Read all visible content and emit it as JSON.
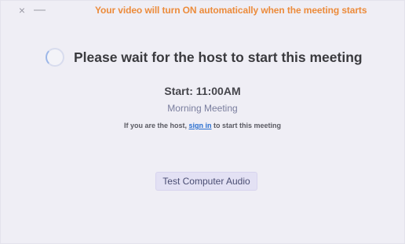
{
  "window": {
    "close_glyph": "×",
    "minimize_glyph": "—"
  },
  "banner": {
    "text": "Your video will turn ON automatically when the meeting starts",
    "color": "#ec8b3b"
  },
  "status": {
    "icon": "loading-spinner-icon",
    "title": "Please wait for the host to start this meeting"
  },
  "meeting": {
    "start_label": "Start: 11:00AM",
    "name": "Morning Meeting"
  },
  "host_prompt": {
    "prefix": "If you are the host, ",
    "link_text": "sign in",
    "suffix": " to start this meeting",
    "link_color": "#2a6fd0"
  },
  "actions": {
    "test_audio_label": "Test Computer Audio"
  }
}
